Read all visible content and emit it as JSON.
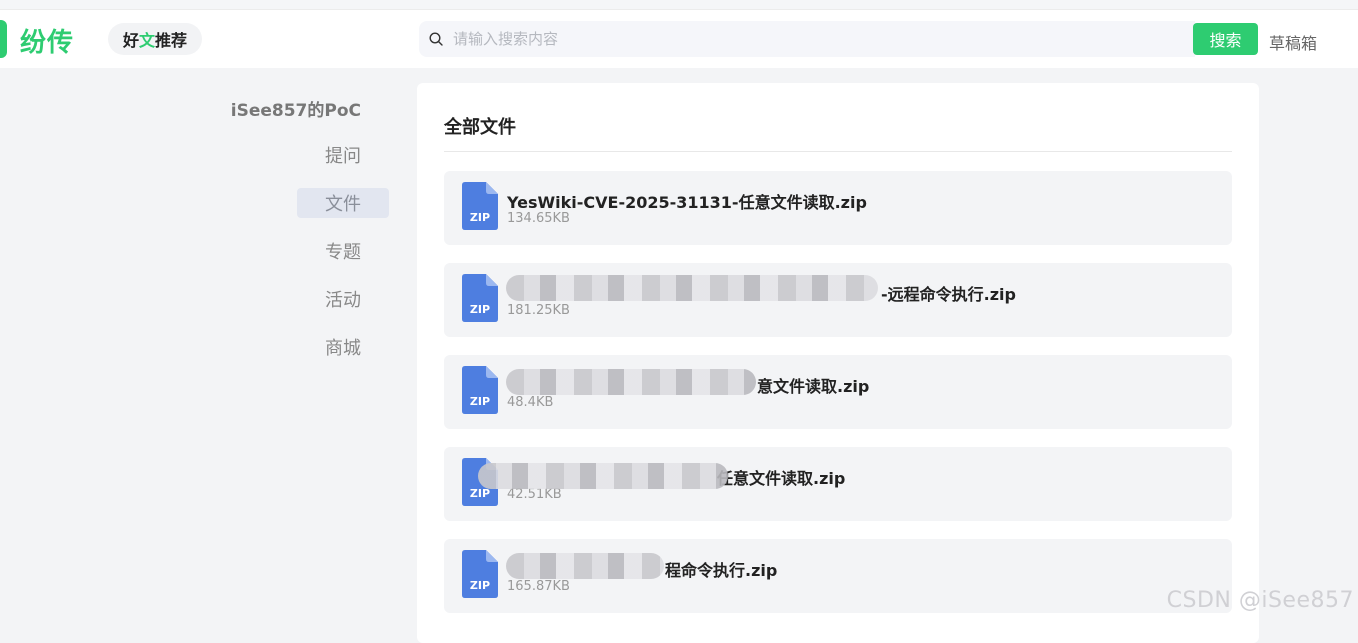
{
  "header": {
    "logo_text": "纷传",
    "recommend_prefix": "好",
    "recommend_accent": "文",
    "recommend_suffix": "推荐",
    "search_placeholder": "请输入搜索内容",
    "search_button": "搜索",
    "drafts_label": "草稿箱"
  },
  "sidebar": {
    "title": "iSee857的PoC",
    "items": [
      {
        "label": "提问"
      },
      {
        "label": "文件"
      },
      {
        "label": "专题"
      },
      {
        "label": "活动"
      },
      {
        "label": "商城"
      }
    ],
    "active_index": 1
  },
  "main": {
    "title": "全部文件",
    "files": [
      {
        "name": "YesWiki-CVE-2025-31131-任意文件读取.zip",
        "size": "134.65KB",
        "icon": "zip-file-icon",
        "icon_label": "ZIP"
      },
      {
        "name": "-远程命令执行.zip",
        "size": "181.25KB",
        "icon": "zip-file-icon",
        "icon_label": "ZIP"
      },
      {
        "name": "意文件读取.zip",
        "size": "48.4KB",
        "icon": "zip-file-icon",
        "icon_label": "ZIP"
      },
      {
        "name": "任意文件读取.zip",
        "size": "42.51KB",
        "icon": "zip-file-icon",
        "icon_label": "ZIP"
      },
      {
        "name": "程命令执行.zip",
        "size": "165.87KB",
        "icon": "zip-file-icon",
        "icon_label": "ZIP"
      }
    ]
  },
  "watermark": "CSDN @iSee857",
  "colors": {
    "brand": "#2ecc71",
    "zip_icon": "#4e7ee0"
  }
}
